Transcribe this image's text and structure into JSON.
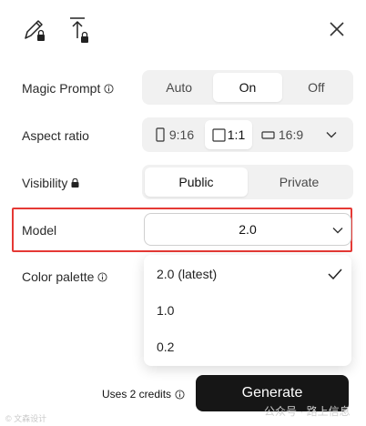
{
  "fields": {
    "magic_prompt": {
      "label": "Magic Prompt",
      "options": [
        "Auto",
        "On",
        "Off"
      ],
      "selected": "On"
    },
    "aspect_ratio": {
      "label": "Aspect ratio",
      "options": [
        "9:16",
        "1:1",
        "16:9"
      ],
      "selected": "1:1"
    },
    "visibility": {
      "label": "Visibility",
      "options": [
        "Public",
        "Private"
      ],
      "selected": "Public"
    },
    "model": {
      "label": "Model",
      "value": "2.0",
      "highlight_color": "#e53935",
      "options": [
        "2.0 (latest)",
        "1.0",
        "0.2"
      ],
      "selected": "2.0 (latest)"
    },
    "color_palette": {
      "label": "Color palette"
    }
  },
  "footer": {
    "credits": "Uses 2 credits",
    "generate": "Generate"
  },
  "watermark": {
    "left": "© 文森设计",
    "right": "公众号 · 路上信息"
  },
  "icons": {
    "tool_1": "edit-pencil-locked-icon",
    "tool_2": "upload-locked-icon",
    "close": "close-icon",
    "info": "info-icon",
    "lock": "lock-icon",
    "chevron": "chevron-down-icon",
    "check": "checkmark-icon"
  }
}
